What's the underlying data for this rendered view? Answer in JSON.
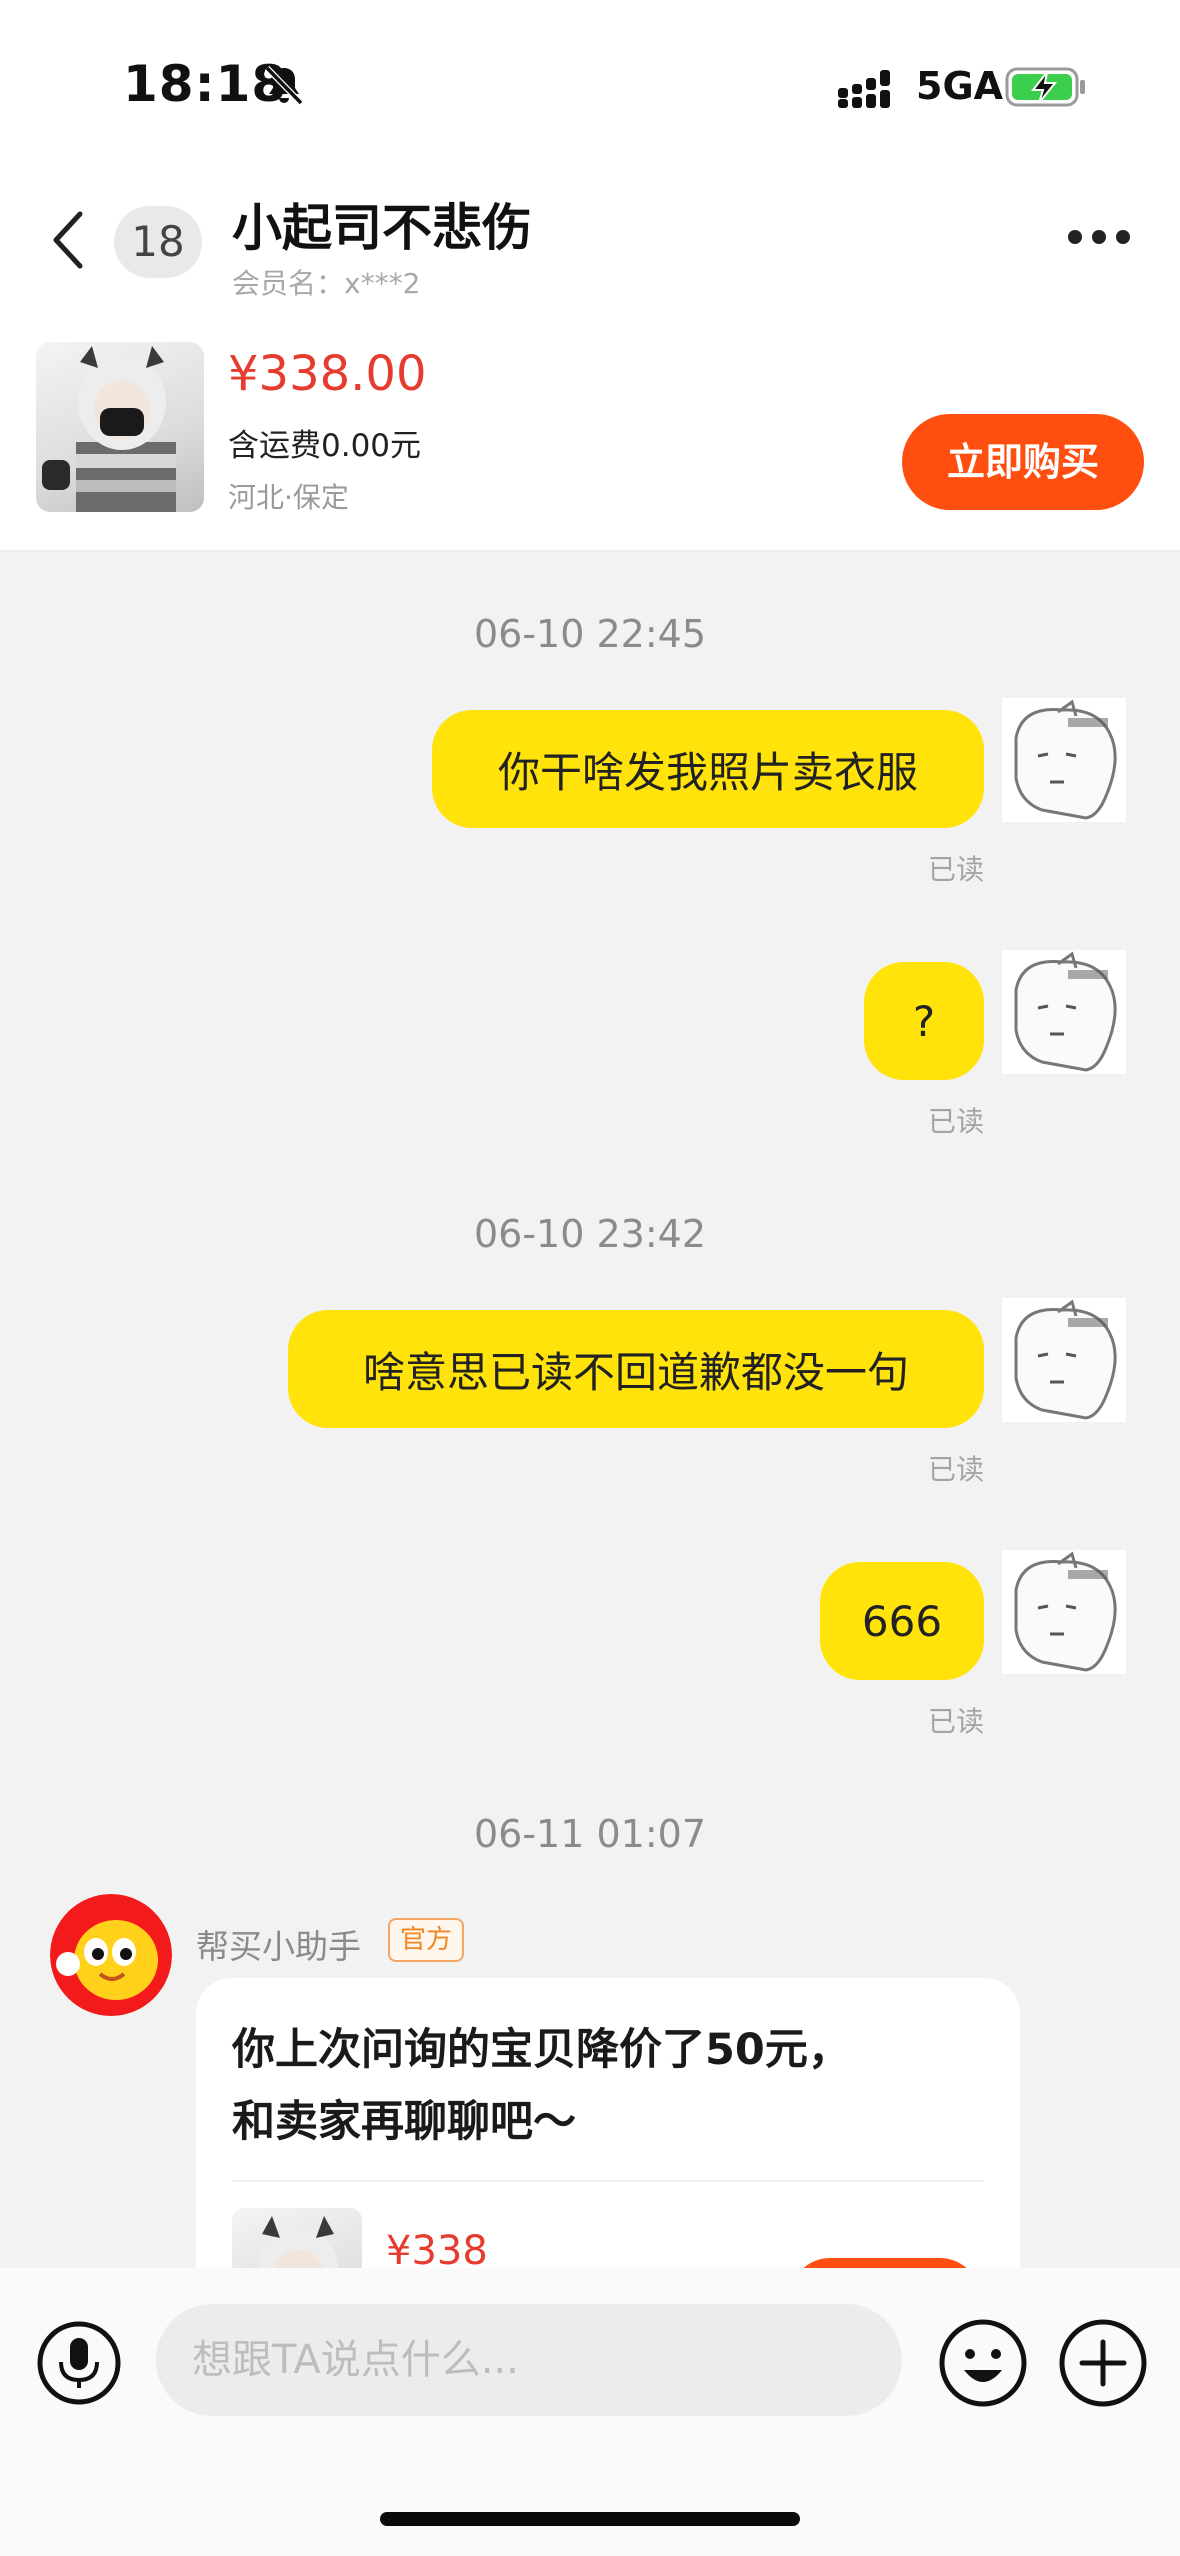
{
  "status_bar": {
    "time": "18:18",
    "network": "5GA"
  },
  "header": {
    "unread_count": "18",
    "title": "小起司不悲伤",
    "member_label": "会员名：",
    "member_name": "x***2"
  },
  "product": {
    "price": "¥338.00",
    "shipping": "含运费0.00元",
    "location": "河北·保定",
    "buy_label": "立即购买"
  },
  "chat": {
    "groups": [
      {
        "timestamp": "06-10 22:45",
        "messages": [
          {
            "text": "你干啥发我照片卖衣服",
            "status": "已读"
          },
          {
            "text": "?",
            "status": "已读"
          }
        ]
      },
      {
        "timestamp": "06-10 23:42",
        "messages": [
          {
            "text": "啥意思已读不回道歉都没一句",
            "status": "已读"
          },
          {
            "text": "666",
            "status": "已读"
          }
        ]
      },
      {
        "timestamp": "06-11 01:07",
        "messages": []
      }
    ],
    "bot": {
      "name": "帮买小助手",
      "tag": "官方",
      "line1": "你上次问询的宝贝降价了50元，",
      "line2": "和卖家再聊聊吧～",
      "price": "¥338"
    }
  },
  "composer": {
    "placeholder": "想跟TA说点什么..."
  },
  "colors": {
    "bubble": "#ffe30a",
    "accent": "#fe4e10",
    "price": "#e63c2f"
  },
  "icons": [
    "bell-off-icon",
    "signal-icon",
    "battery-charging-icon",
    "back-arrow-icon",
    "more-icon",
    "microphone-icon",
    "emoji-icon",
    "plus-icon"
  ]
}
